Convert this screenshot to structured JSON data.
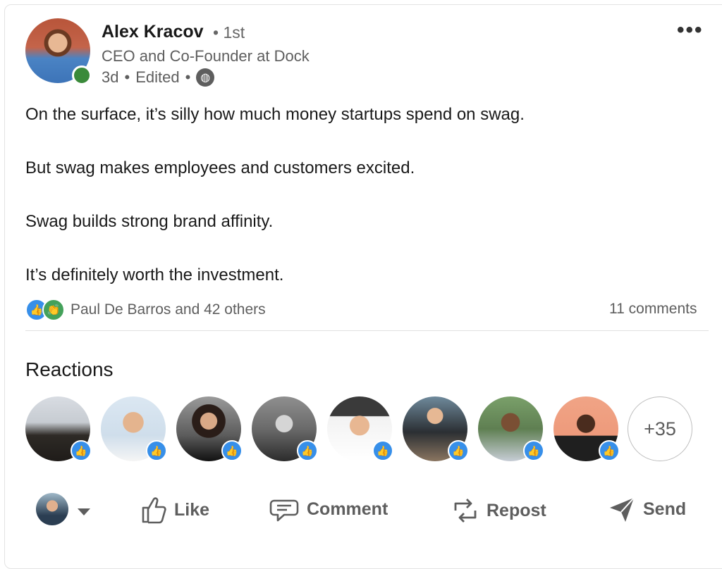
{
  "author": {
    "name": "Alex Kracov",
    "degree": "• 1st",
    "headline": "CEO and Co-Founder at Dock",
    "posted": "3d",
    "edited": "Edited",
    "visibility_icon": "globe-icon",
    "online": true
  },
  "post": {
    "paragraphs": [
      "On the surface, it’s silly how much money startups spend on swag.",
      "But swag makes employees and customers excited.",
      "Swag builds strong brand affinity.",
      "It’s definitely worth the investment."
    ]
  },
  "social": {
    "reaction_icons": [
      "like-icon",
      "celebrate-icon"
    ],
    "reactors_text": "Paul De Barros and 42 others",
    "comments_text": "11 comments"
  },
  "reactions": {
    "title": "Reactions",
    "more_count": "+35",
    "people_reaction": "like"
  },
  "actions": {
    "like": "Like",
    "comment": "Comment",
    "repost": "Repost",
    "send": "Send"
  },
  "colors": {
    "like_blue": "#378fe9",
    "celebrate_green": "#44a15a",
    "online_green": "#3a8a3a",
    "text_primary": "#191919",
    "text_secondary": "#5e5e5e"
  }
}
